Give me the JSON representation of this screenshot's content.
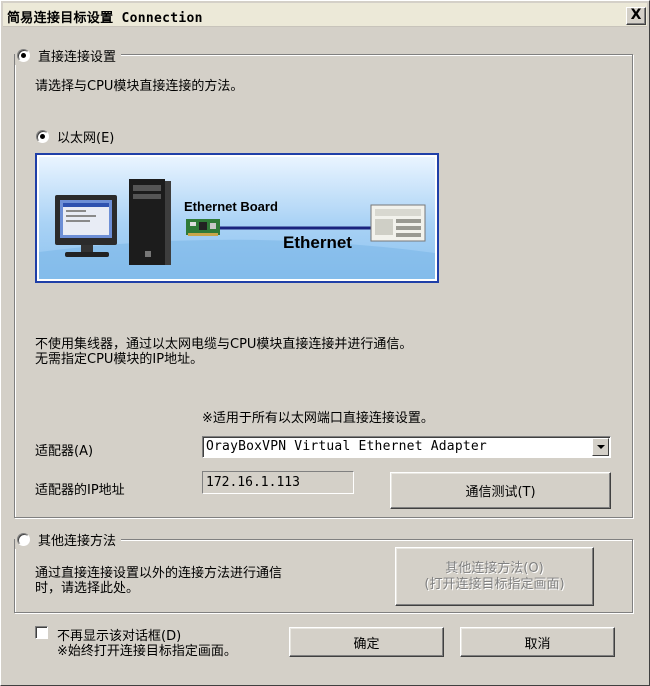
{
  "window": {
    "title": "简易连接目标设置 Connection",
    "close_label": "X"
  },
  "direct": {
    "legend": "直接连接设置",
    "selected": true,
    "description": "请选择与CPU模块直接连接的方法。",
    "ethernet": {
      "label": "以太网(E)",
      "selected": true,
      "banner": {
        "board_label": "Ethernet Board",
        "cable_label": "Ethernet"
      }
    },
    "info_line1": "不使用集线器，通过以太网电缆与CPU模块直接连接并进行通信。",
    "info_line2": "无需指定CPU模块的IP地址。",
    "note": "※适用于所有以太网端口直接连接设置。",
    "adapter": {
      "label": "适配器(A)",
      "value": "OrayBoxVPN Virtual Ethernet Adapter"
    },
    "ip": {
      "label": "适配器的IP地址",
      "value": "172.16.1.113"
    },
    "test_button": "通信测试(T)"
  },
  "other": {
    "legend": "其他连接方法",
    "selected": false,
    "description_line1": "通过直接连接设置以外的连接方法进行通信",
    "description_line2": "时，请选择此处。",
    "button_line1": "其他连接方法(O)",
    "button_line2": "(打开连接目标指定画面)"
  },
  "footer": {
    "checkbox_label": "不再显示该对话框(D)",
    "checkbox_note": "※始终打开连接目标指定画面。",
    "checkbox_checked": false,
    "ok_button": "确定",
    "cancel_button": "取消"
  },
  "colors": {
    "dialog_bg": "#d4d0c8",
    "banner_border": "#1f3fa8",
    "banner_sky": "#a9d2f5",
    "disabled_text": "#808080"
  },
  "icons": [
    "close-icon",
    "computer-icon",
    "ethernet-board-icon",
    "plc-cpu-icon",
    "dropdown-arrow-icon"
  ]
}
